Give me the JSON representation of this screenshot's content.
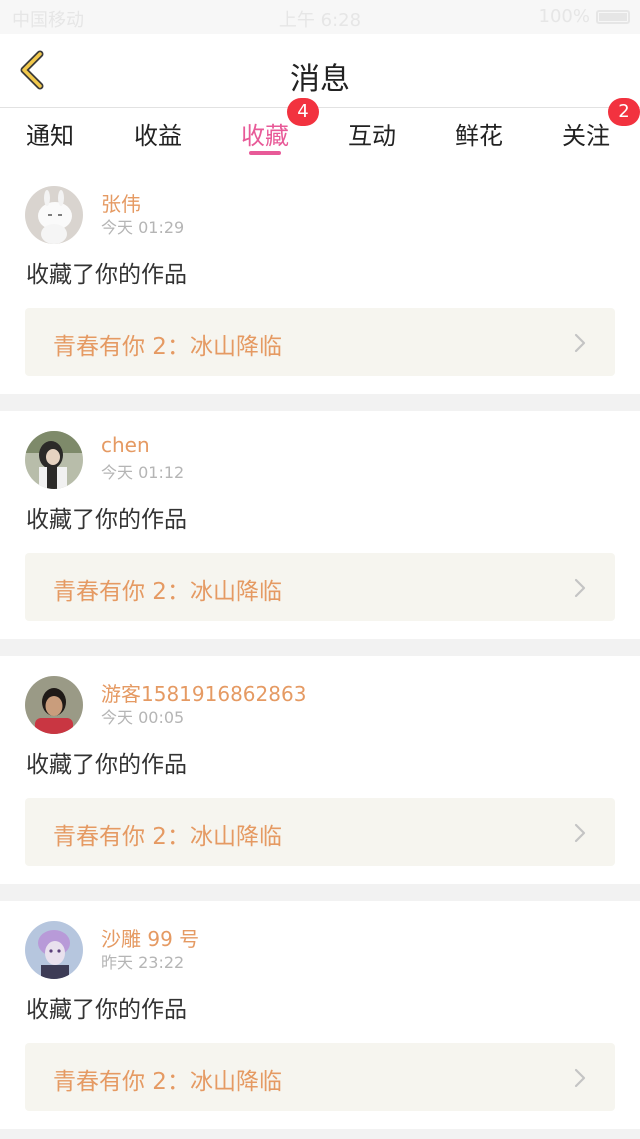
{
  "status_bar": {
    "carrier": "中国移动",
    "time": "上午 6:28",
    "battery": "100%"
  },
  "header": {
    "title": "消息",
    "back_icon": "chevron-left-icon"
  },
  "tabs": [
    {
      "label": "通知",
      "active": false,
      "badge": ""
    },
    {
      "label": "收益",
      "active": false,
      "badge": ""
    },
    {
      "label": "收藏",
      "active": true,
      "badge": "4"
    },
    {
      "label": "互动",
      "active": false,
      "badge": ""
    },
    {
      "label": "鲜花",
      "active": false,
      "badge": ""
    },
    {
      "label": "关注",
      "active": false,
      "badge": "2"
    }
  ],
  "colors": {
    "accent": "#e85a98",
    "name": "#e59a63",
    "badge": "#f2323f"
  },
  "items": [
    {
      "name": "张伟",
      "time": "今天 01:29",
      "action": "收藏了你的作品",
      "work": "青春有你 2：冰山降临"
    },
    {
      "name": "chen",
      "time": "今天 01:12",
      "action": "收藏了你的作品",
      "work": "青春有你 2：冰山降临"
    },
    {
      "name": "游客1581916862863",
      "time": "今天 00:05",
      "action": "收藏了你的作品",
      "work": "青春有你 2：冰山降临"
    },
    {
      "name": "沙雕 99 号",
      "time": "昨天 23:22",
      "action": "收藏了你的作品",
      "work": "青春有你 2：冰山降临"
    }
  ]
}
